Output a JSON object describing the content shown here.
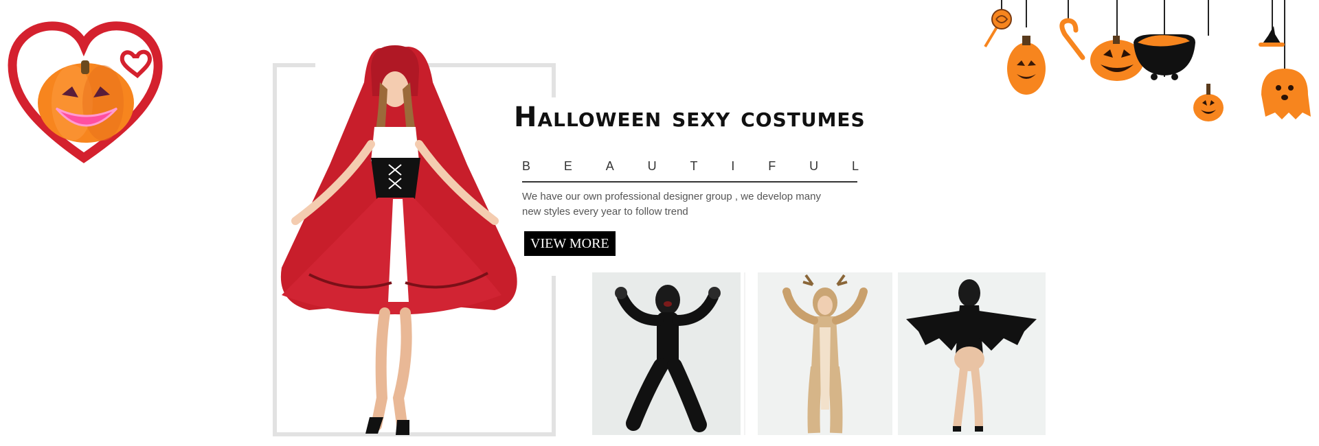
{
  "banner": {
    "headline": "Halloween sexy costumes",
    "subheading_letters": [
      "B",
      "E",
      "A",
      "U",
      "T",
      "I",
      "F",
      "U",
      "L"
    ],
    "description_line1": "We have our own professional designer group , we develop many",
    "description_line2": "new styles every year to follow trend",
    "cta_label": "VIEW MORE"
  },
  "colors": {
    "heart_red": "#d4212e",
    "pumpkin_orange": "#f7851e",
    "cape_red": "#c81e2b",
    "cta_bg": "#000000",
    "frame_gray": "#e2e2e2"
  },
  "icons": {
    "logo": "heart-pumpkin-icon",
    "decorations": [
      "lollipop-icon",
      "pumpkin-lantern-icon",
      "candy-cane-icon",
      "jack-o-lantern-icon",
      "cauldron-icon",
      "small-pumpkin-icon",
      "witch-hat-icon",
      "ghost-icon"
    ]
  },
  "thumbnails": [
    "gorilla-costume",
    "deer-jumpsuit-costume",
    "bat-wing-costume"
  ]
}
